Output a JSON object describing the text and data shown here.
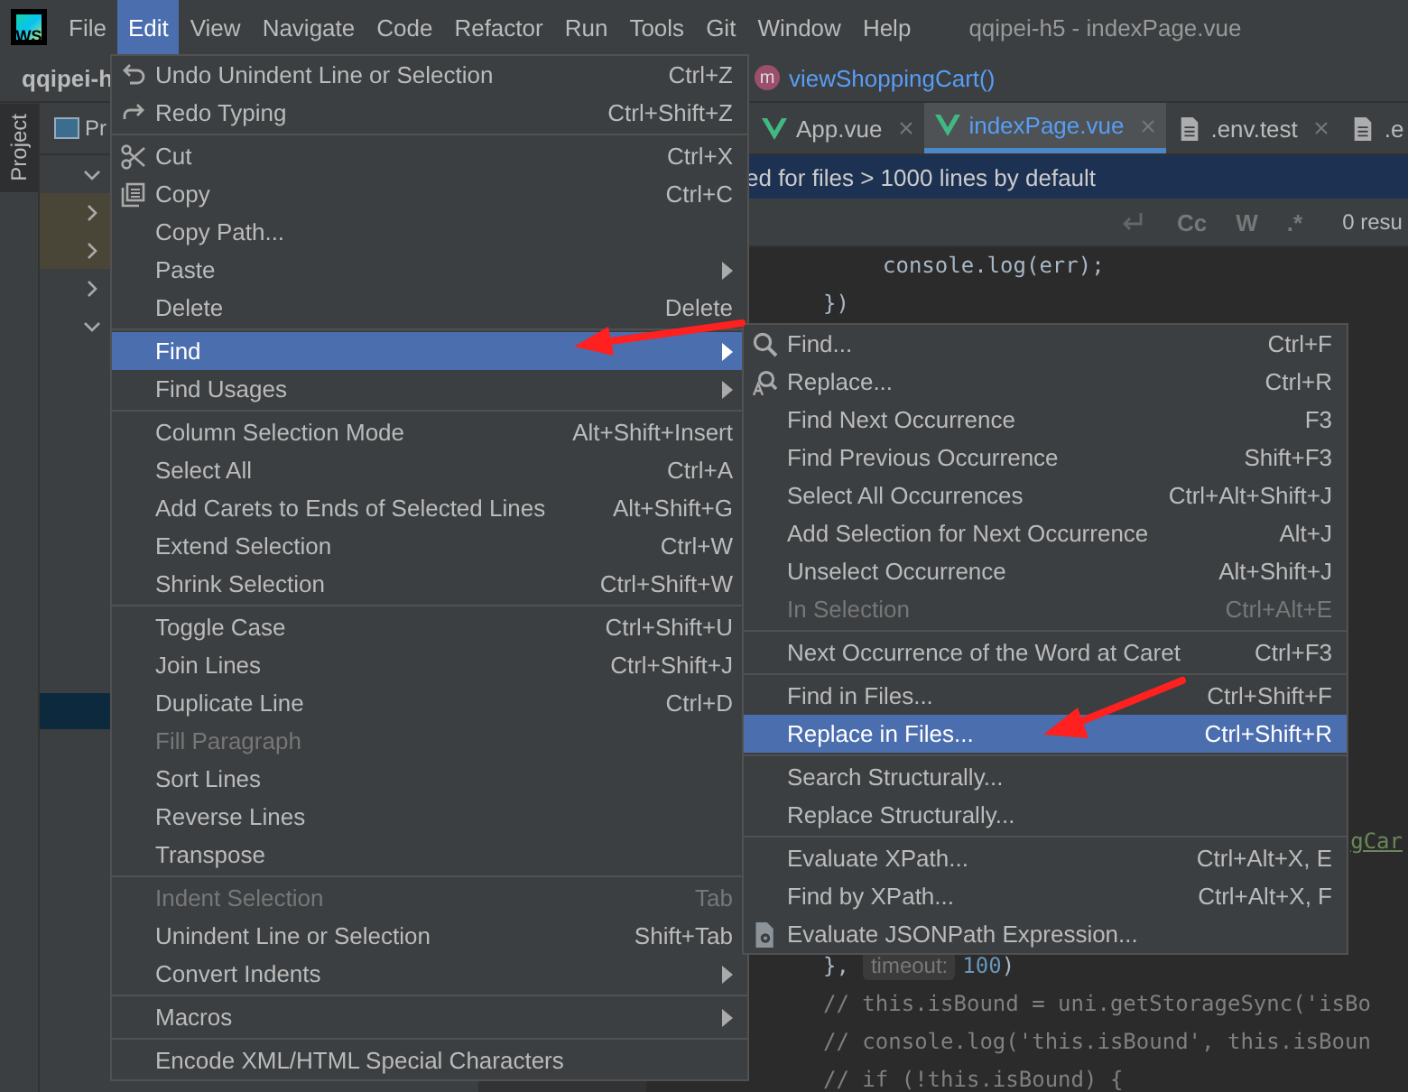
{
  "logo": "WS",
  "menubar": [
    {
      "label": "File",
      "selected": false
    },
    {
      "label": "Edit",
      "selected": true
    },
    {
      "label": "View",
      "selected": false
    },
    {
      "label": "Navigate",
      "selected": false
    },
    {
      "label": "Code",
      "selected": false
    },
    {
      "label": "Refactor",
      "selected": false
    },
    {
      "label": "Run",
      "selected": false
    },
    {
      "label": "Tools",
      "selected": false
    },
    {
      "label": "Git",
      "selected": false
    },
    {
      "label": "Window",
      "selected": false
    },
    {
      "label": "Help",
      "selected": false
    }
  ],
  "window_title": "qqipei-h5 - indexPage.vue",
  "navbar": {
    "project": "qqipei-h",
    "method_badge": "m",
    "method": "viewShoppingCart()"
  },
  "tool_stripe": {
    "label": "Project",
    "selected": true
  },
  "project_panel": {
    "header": "Pr",
    "tree": [
      {
        "expanded": true
      },
      {
        "expanded": false
      },
      {
        "expanded": false
      },
      {
        "expanded": false
      },
      {
        "expanded": true
      }
    ]
  },
  "editor_tabs": [
    {
      "label": "App.vue",
      "kind": "vue",
      "selected": false
    },
    {
      "label": "indexPage.vue",
      "kind": "vue",
      "selected": true
    },
    {
      "label": ".env.test",
      "kind": "file",
      "selected": false
    },
    {
      "label": ".e",
      "kind": "file",
      "selected": false
    }
  ],
  "notice": "ed for files > 1000 lines by default",
  "search_toolbar": {
    "options": [
      "Cc",
      "W",
      ".*"
    ],
    "results": "0 resu"
  },
  "code_top": [
    {
      "kind": "inner",
      "segments": [
        {
          "text": "console.log(err);",
          "kind": "code"
        }
      ]
    },
    {
      "kind": "outer",
      "segments": [
        {
          "text": "})",
          "kind": "code"
        }
      ]
    }
  ],
  "code_bottom": [
    {
      "kind": "partial",
      "segments": [
        {
          "text": "gCar",
          "kind": "link"
        }
      ]
    },
    {
      "kind": "outer",
      "segments": [
        {
          "text": "},",
          "kind": "code"
        },
        {
          "text": "timeout:",
          "kind": "hint"
        },
        {
          "text": "100",
          "kind": "number"
        },
        {
          "text": ")",
          "kind": "code"
        }
      ]
    },
    {
      "kind": "outer",
      "segments": [
        {
          "text": "// this.isBound = uni.getStorageSync('isBo",
          "kind": "comment"
        }
      ]
    },
    {
      "kind": "outer",
      "segments": [
        {
          "text": "// console.log('this.isBound', this.isBoun",
          "kind": "comment"
        }
      ]
    },
    {
      "kind": "outer",
      "segments": [
        {
          "text": "// if (!this.isBound) {",
          "kind": "comment"
        }
      ]
    }
  ],
  "edit_menu": [
    [
      {
        "label": "Undo Unindent Line or Selection",
        "shortcut": "Ctrl+Z",
        "disabled": false,
        "selected": false,
        "submenu": false
      },
      {
        "label": "Redo Typing",
        "shortcut": "Ctrl+Shift+Z",
        "disabled": false,
        "selected": false,
        "submenu": false
      }
    ],
    [
      {
        "label": "Cut",
        "shortcut": "Ctrl+X",
        "disabled": false,
        "selected": false,
        "submenu": false
      },
      {
        "label": "Copy",
        "shortcut": "Ctrl+C",
        "disabled": false,
        "selected": false,
        "submenu": false
      },
      {
        "label": "Copy Path...",
        "disabled": false,
        "selected": false,
        "submenu": false
      },
      {
        "label": "Paste",
        "disabled": false,
        "selected": false,
        "submenu": true
      },
      {
        "label": "Delete",
        "shortcut": "Delete",
        "disabled": false,
        "selected": false,
        "submenu": false
      }
    ],
    [
      {
        "label": "Find",
        "disabled": false,
        "selected": true,
        "submenu": true
      },
      {
        "label": "Find Usages",
        "disabled": false,
        "selected": false,
        "submenu": true
      }
    ],
    [
      {
        "label": "Column Selection Mode",
        "shortcut": "Alt+Shift+Insert",
        "disabled": false,
        "selected": false,
        "submenu": false
      },
      {
        "label": "Select All",
        "shortcut": "Ctrl+A",
        "disabled": false,
        "selected": false,
        "submenu": false
      },
      {
        "label": "Add Carets to Ends of Selected Lines",
        "shortcut": "Alt+Shift+G",
        "disabled": false,
        "selected": false,
        "submenu": false
      },
      {
        "label": "Extend Selection",
        "shortcut": "Ctrl+W",
        "disabled": false,
        "selected": false,
        "submenu": false
      },
      {
        "label": "Shrink Selection",
        "shortcut": "Ctrl+Shift+W",
        "disabled": false,
        "selected": false,
        "submenu": false
      }
    ],
    [
      {
        "label": "Toggle Case",
        "shortcut": "Ctrl+Shift+U",
        "disabled": false,
        "selected": false,
        "submenu": false
      },
      {
        "label": "Join Lines",
        "shortcut": "Ctrl+Shift+J",
        "disabled": false,
        "selected": false,
        "submenu": false
      },
      {
        "label": "Duplicate Line",
        "shortcut": "Ctrl+D",
        "disabled": false,
        "selected": false,
        "submenu": false
      },
      {
        "label": "Fill Paragraph",
        "disabled": true,
        "selected": false,
        "submenu": false
      },
      {
        "label": "Sort Lines",
        "disabled": false,
        "selected": false,
        "submenu": false
      },
      {
        "label": "Reverse Lines",
        "disabled": false,
        "selected": false,
        "submenu": false
      },
      {
        "label": "Transpose",
        "disabled": false,
        "selected": false,
        "submenu": false
      }
    ],
    [
      {
        "label": "Indent Selection",
        "shortcut": "Tab",
        "disabled": true,
        "selected": false,
        "submenu": false
      },
      {
        "label": "Unindent Line or Selection",
        "shortcut": "Shift+Tab",
        "disabled": false,
        "selected": false,
        "submenu": false
      },
      {
        "label": "Convert Indents",
        "disabled": false,
        "selected": false,
        "submenu": true
      }
    ],
    [
      {
        "label": "Macros",
        "disabled": false,
        "selected": false,
        "submenu": true
      }
    ],
    [
      {
        "label": "Encode XML/HTML Special Characters",
        "disabled": false,
        "selected": false,
        "submenu": false
      }
    ]
  ],
  "find_submenu": [
    [
      {
        "label": "Find...",
        "shortcut": "Ctrl+F",
        "disabled": false,
        "selected": false
      },
      {
        "label": "Replace...",
        "shortcut": "Ctrl+R",
        "disabled": false,
        "selected": false
      },
      {
        "label": "Find Next Occurrence",
        "shortcut": "F3",
        "disabled": false,
        "selected": false
      },
      {
        "label": "Find Previous Occurrence",
        "shortcut": "Shift+F3",
        "disabled": false,
        "selected": false
      },
      {
        "label": "Select All Occurrences",
        "shortcut": "Ctrl+Alt+Shift+J",
        "disabled": false,
        "selected": false
      },
      {
        "label": "Add Selection for Next Occurrence",
        "shortcut": "Alt+J",
        "disabled": false,
        "selected": false
      },
      {
        "label": "Unselect Occurrence",
        "shortcut": "Alt+Shift+J",
        "disabled": false,
        "selected": false
      },
      {
        "label": "In Selection",
        "shortcut": "Ctrl+Alt+E",
        "disabled": true,
        "selected": false
      }
    ],
    [
      {
        "label": "Next Occurrence of the Word at Caret",
        "shortcut": "Ctrl+F3",
        "disabled": false,
        "selected": false
      }
    ],
    [
      {
        "label": "Find in Files...",
        "shortcut": "Ctrl+Shift+F",
        "disabled": false,
        "selected": false
      },
      {
        "label": "Replace in Files...",
        "shortcut": "Ctrl+Shift+R",
        "disabled": false,
        "selected": true
      }
    ],
    [
      {
        "label": "Search Structurally...",
        "disabled": false,
        "selected": false
      },
      {
        "label": "Replace Structurally...",
        "disabled": false,
        "selected": false
      }
    ],
    [
      {
        "label": "Evaluate XPath...",
        "shortcut": "Ctrl+Alt+X, E",
        "disabled": false,
        "selected": false
      },
      {
        "label": "Find by XPath...",
        "shortcut": "Ctrl+Alt+X, F",
        "disabled": false,
        "selected": false
      },
      {
        "label": "Evaluate JSONPath Expression...",
        "disabled": false,
        "selected": false
      }
    ]
  ]
}
